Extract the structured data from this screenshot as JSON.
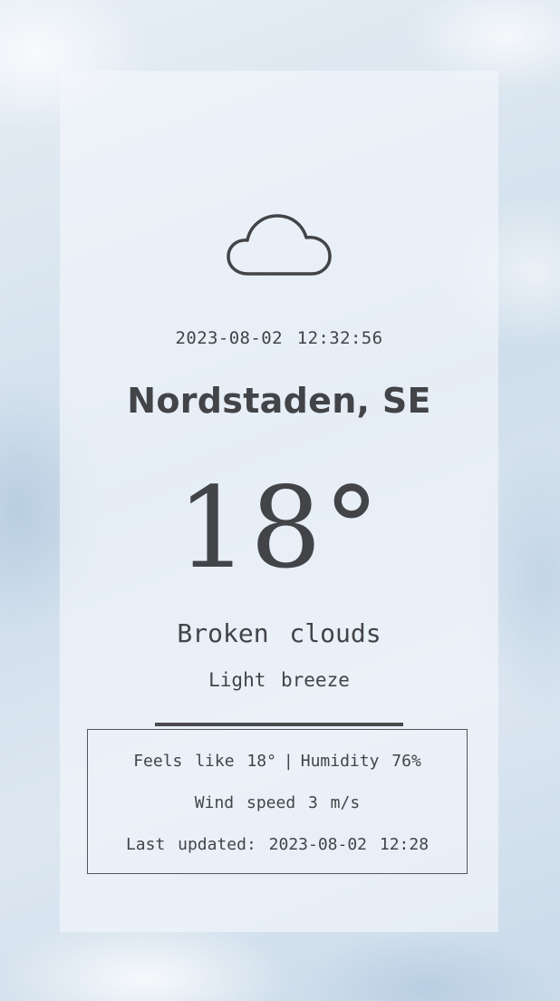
{
  "weather": {
    "icon": "cloud-icon",
    "datetime": "2023-08-02 12:32:56",
    "location": "Nordstaden, SE",
    "temperature": "18°",
    "condition": "Broken clouds",
    "wind_description": "Light breeze"
  },
  "details": {
    "feels_like": "Feels like 18°",
    "separator": "|",
    "humidity": "Humidity 76%",
    "wind_speed": "Wind speed 3 m/s",
    "last_updated": "Last updated: 2023-08-02 12:28"
  },
  "colors": {
    "text": "#424448",
    "card_bg": "#f4f7fb",
    "background": "#d9e4ee"
  }
}
